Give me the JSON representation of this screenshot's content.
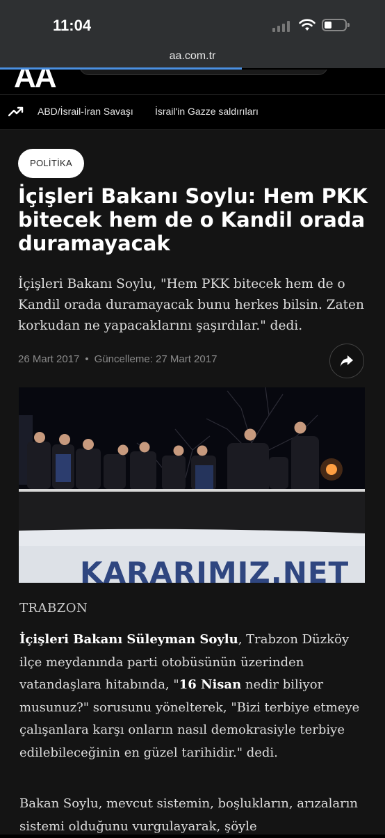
{
  "status_bar": {
    "time": "11:04"
  },
  "browser": {
    "url": "aa.com.tr"
  },
  "site": {
    "logo": "AA"
  },
  "trending": {
    "items": [
      "ABD/İsrail-İran Savaşı",
      "İsrail'in Gazze saldırıları"
    ]
  },
  "article": {
    "category": "POLİTİKA",
    "title": "İçişleri Bakanı Soylu: Hem PKK bitecek hem de o Kandil orada duramayacak",
    "lead": "İçişleri Bakanı Soylu, \"Hem PKK bitecek hem de o Kandil orada duramayacak bunu herkes bilsin. Zaten korkudan ne yapacaklarını şaşırdılar.\" dedi.",
    "date": "26 Mart 2017",
    "updated": "Güncelleme: 27 Mart 2017",
    "image_text": "KARARIMIZ.NET",
    "location": "TRABZON",
    "body1_bold1": "İçişleri Bakanı Süleyman Soylu",
    "body1_text1": ", Trabzon Düzköy ilçe meydanında parti otobüsünün üzerinden vatandaşlara hitabında, \"",
    "body1_bold2": "16 Nisan",
    "body1_text2": " nedir biliyor musunuz?\" sorusunu yönelterek, \"Bizi terbiye etmeye çalışanlara karşı onların nasıl demokrasiyle terbiye edilebileceğinin en güzel tarihidir.\" dedi.",
    "body2": "Bakan Soylu, mevcut sistemin, boşlukların, arızaların sistemi olduğunu vurgulayarak, şöyle"
  }
}
